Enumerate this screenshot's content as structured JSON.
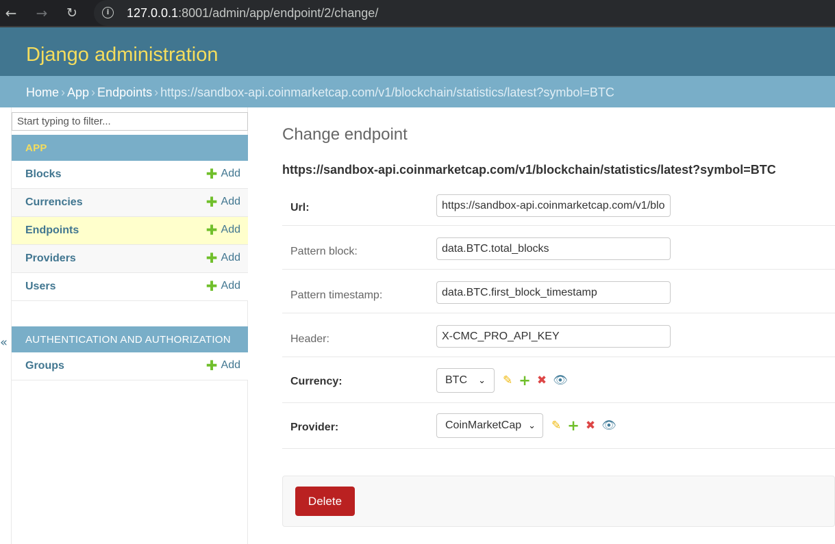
{
  "browser": {
    "url_host": "127.0.0.1",
    "url_rest": ":8001/admin/app/endpoint/2/change/",
    "back_icon": "←",
    "forward_icon": "→",
    "reload_icon": "↻",
    "info_icon": "i"
  },
  "header": {
    "site_title": "Django administration"
  },
  "breadcrumbs": {
    "home": "Home",
    "app": "App",
    "model": "Endpoints",
    "current": "https://sandbox-api.coinmarketcap.com/v1/blockchain/statistics/latest?symbol=BTC",
    "separator": "›"
  },
  "sidebar": {
    "filter_placeholder": "Start typing to filter...",
    "collapse_icon": "«",
    "add_label": "Add",
    "add_icon": "✚",
    "modules": [
      {
        "caption": "APP",
        "items": [
          {
            "name": "Blocks"
          },
          {
            "name": "Currencies"
          },
          {
            "name": "Endpoints"
          },
          {
            "name": "Providers"
          },
          {
            "name": "Users"
          }
        ]
      },
      {
        "caption": "AUTHENTICATION AND AUTHORIZATION",
        "items": [
          {
            "name": "Groups"
          }
        ]
      }
    ]
  },
  "content": {
    "page_title": "Change endpoint",
    "object_title": "https://sandbox-api.coinmarketcap.com/v1/blockchain/statistics/latest?symbol=BTC",
    "fields": {
      "url": {
        "label": "Url:",
        "value": "https://sandbox-api.coinmarketcap.com/v1/blockchain/statistics/latest?symbol=BTC"
      },
      "pattern_block": {
        "label": "Pattern block:",
        "value": "data.BTC.total_blocks"
      },
      "pattern_timestamp": {
        "label": "Pattern timestamp:",
        "value": "data.BTC.first_block_timestamp"
      },
      "header": {
        "label": "Header:",
        "value": "X-CMC_PRO_API_KEY"
      },
      "currency": {
        "label": "Currency:",
        "value": "BTC"
      },
      "provider": {
        "label": "Provider:",
        "value": "CoinMarketCap"
      }
    },
    "related_icons": {
      "edit": "✎",
      "add": "+",
      "delete": "✖",
      "view": "👁"
    },
    "select_arrow": "⌄",
    "delete_label": "Delete"
  },
  "colors": {
    "header_bg": "#417690",
    "breadcrumb_bg": "#79aec8",
    "title_yellow": "#f5dd5d",
    "delete_red": "#ba2121",
    "selected_row": "#ffffcc"
  }
}
